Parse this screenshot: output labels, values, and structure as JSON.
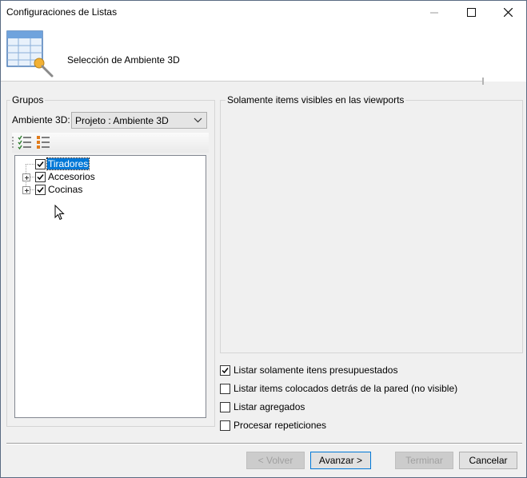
{
  "window": {
    "title": "Configuraciones de Listas"
  },
  "header": {
    "step_title": "Selección de Ambiente 3D"
  },
  "groups": {
    "label": "Grupos",
    "ambiente_label": "Ambiente 3D:",
    "ambiente_value": "Projeto : Ambiente 3D",
    "tree": [
      {
        "label": "Tiradores",
        "checked": true,
        "expandable": false,
        "selected": true
      },
      {
        "label": "Accesorios",
        "checked": true,
        "expandable": true,
        "selected": false
      },
      {
        "label": "Cocinas",
        "checked": true,
        "expandable": true,
        "selected": false
      }
    ]
  },
  "viewports": {
    "label": "Solamente items visibles en las viewports"
  },
  "options": [
    {
      "label": "Listar solamente itens presupuestados",
      "checked": true
    },
    {
      "label": "Listar items colocados detrás de la pared (no visible)",
      "checked": false
    },
    {
      "label": "Listar agregados",
      "checked": false
    },
    {
      "label": "Procesar repeticiones",
      "checked": false
    }
  ],
  "buttons": {
    "back": "< Volver",
    "next": "Avanzar >",
    "finish": "Terminar",
    "cancel": "Cancelar"
  },
  "icons": {
    "toolbar": [
      "check-all-icon",
      "uncheck-all-icon"
    ],
    "title": [
      "minimize-icon",
      "maximize-icon",
      "close-icon"
    ]
  }
}
